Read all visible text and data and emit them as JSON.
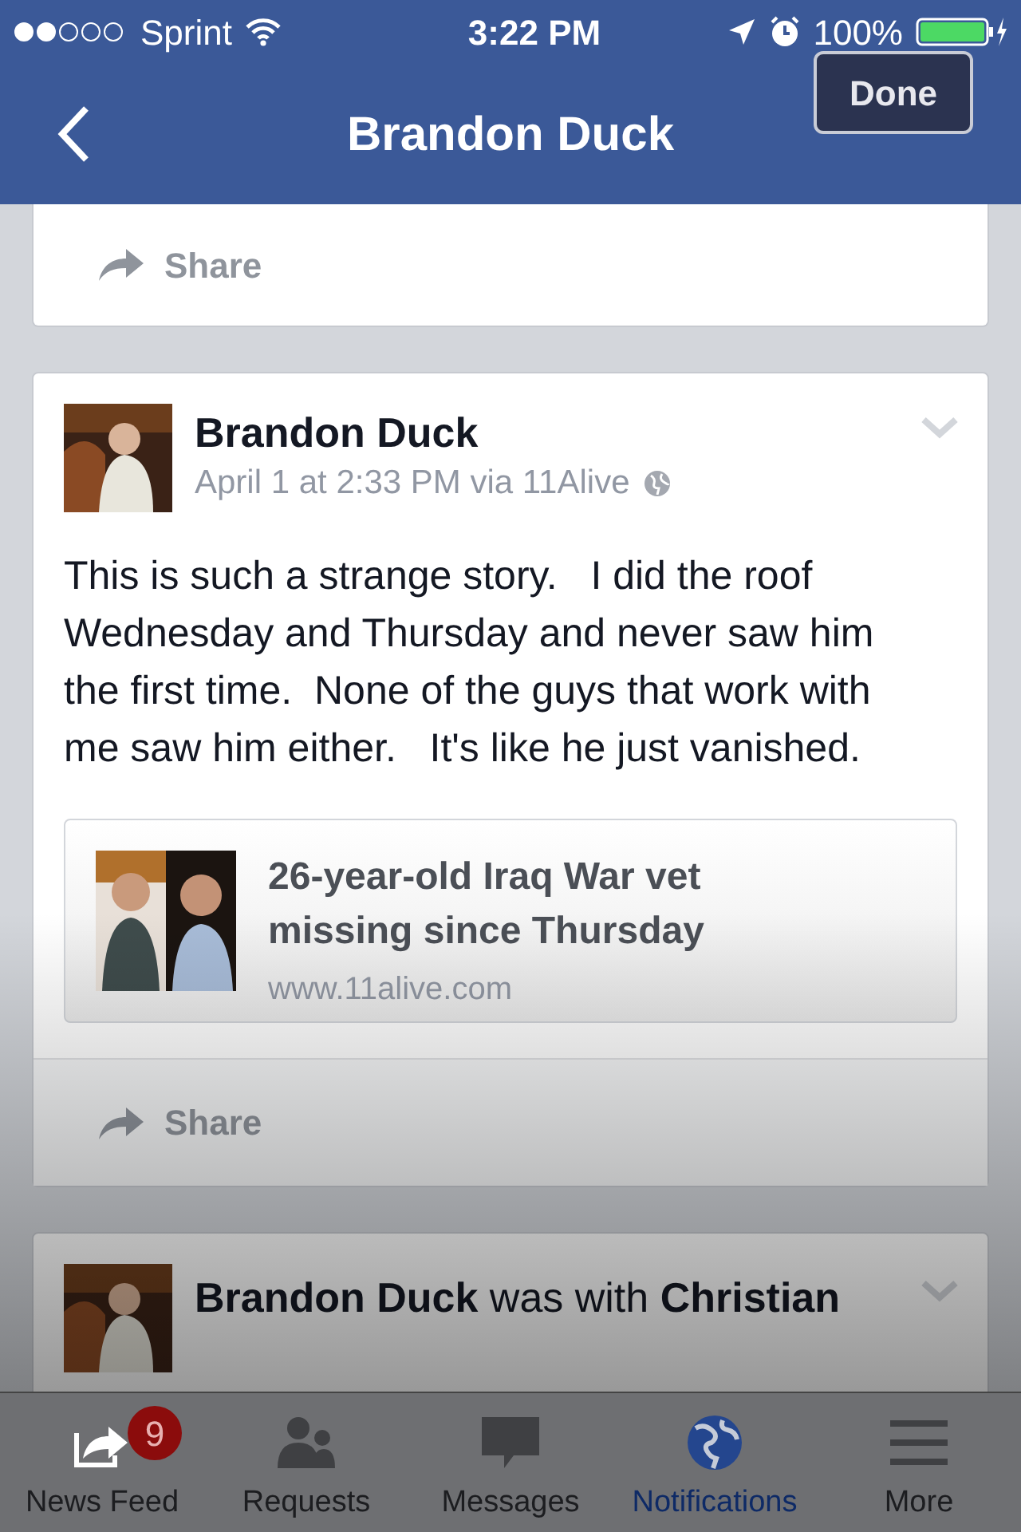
{
  "status_bar": {
    "carrier": "Sprint",
    "time": "3:22 PM",
    "battery": "100%"
  },
  "nav": {
    "title": "Brandon Duck",
    "done": "Done"
  },
  "posts": [
    {
      "kind": "tail",
      "actions": [
        "Share"
      ]
    },
    {
      "kind": "full",
      "author": "Brandon Duck",
      "meta": "April 1 at 2:33 PM via 11Alive",
      "text": "This is such a strange story.   I did the roof Wednesday and Thursday and never saw him the first time.  None of the guys that work with me saw him either.   It's like he just vanished.",
      "link": {
        "title": "26-year-old Iraq War vet missing since Thursday",
        "url": "www.11alive.com"
      },
      "actions": [
        "Share"
      ]
    },
    {
      "kind": "story",
      "headline": "**Brandon Duck** was with **Christian**"
    }
  ],
  "tabs": [
    {
      "label": "News Feed",
      "selected": false,
      "badge": "9"
    },
    {
      "label": "Requests",
      "selected": false
    },
    {
      "label": "Messages",
      "selected": false
    },
    {
      "label": "Notifications",
      "selected": true
    },
    {
      "label": "More",
      "selected": false
    }
  ]
}
